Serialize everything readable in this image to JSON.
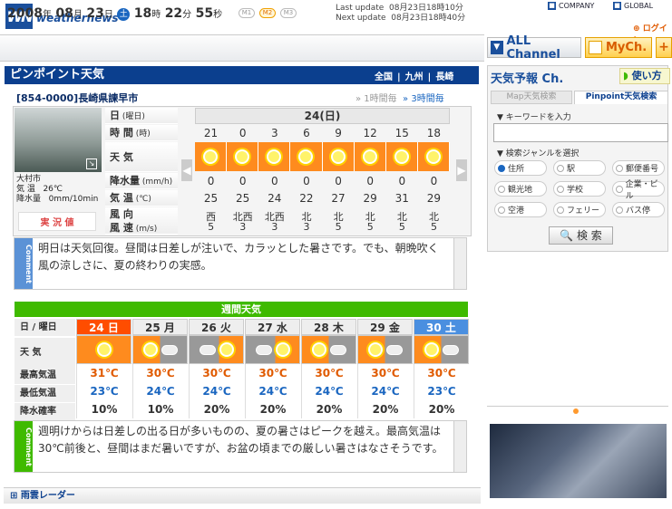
{
  "header": {
    "logo_mark": "WN",
    "logo_text": "weathernews",
    "links": {
      "company": "COMPANY",
      "global": "GLOBAL"
    },
    "login": "ログイン"
  },
  "datebar": {
    "year": "2008",
    "year_unit": "年",
    "month": "08",
    "month_unit": "月",
    "day": "23",
    "day_unit": "日",
    "day_of_week": "土",
    "hour": "18",
    "hour_unit": "時",
    "minute": "22",
    "minute_unit": "分",
    "second": "55",
    "second_unit": "秒",
    "levels": [
      "M1",
      "M2",
      "M3"
    ],
    "update_text": "Last update  08月23日18時10分\nNext update  08月23日18時40分"
  },
  "channels": {
    "all": "ALL Channel",
    "my": "MyCh.",
    "plus": "+"
  },
  "pinpoint": {
    "title": "ピンポイント天気",
    "breadcrumb": [
      "全国",
      "九州",
      "長崎"
    ],
    "location": "[854-0000]長崎県諫早市",
    "tab_1h": "1時間毎",
    "tab_3h": "3時間毎",
    "cam_city": "大村市",
    "cam_info": "気 温   26℃\n降水量   0mm/10min",
    "jikkyo": "実 況 値",
    "labels": {
      "day": "日",
      "day_unit": "(曜日)",
      "time": "時 間",
      "time_unit": "(時)",
      "weather": "天 気",
      "rain": "降水量",
      "rain_unit": "(mm/h)",
      "temp": "気 温",
      "temp_unit": "(℃)",
      "wind_dir": "風 向",
      "wind_speed": "風 速",
      "wind_unit": "(m/s)"
    },
    "date": "24(日)",
    "hours": [
      "21",
      "0",
      "3",
      "6",
      "9",
      "12",
      "15",
      "18"
    ],
    "weather_icons": [
      "sun-icon",
      "sun-icon",
      "sun-icon",
      "sun-icon",
      "sun-icon",
      "sun-icon",
      "sun-icon",
      "sun-icon"
    ],
    "rain": [
      "0",
      "0",
      "0",
      "0",
      "0",
      "0",
      "0",
      "0"
    ],
    "temps": [
      "25",
      "25",
      "24",
      "22",
      "27",
      "29",
      "31",
      "29"
    ],
    "wind_dirs": [
      "西",
      "北西",
      "北西",
      "北",
      "北",
      "北",
      "北",
      "北"
    ],
    "wind_speeds": [
      "5",
      "3",
      "3",
      "3",
      "5",
      "5",
      "5",
      "5"
    ],
    "comment_label": "Comment",
    "comment": "明日は天気回復。昼間は日差しが注いで、カラッとした暑さです。でも、朝晩吹く風の涼しさに、夏の終わりの実感。"
  },
  "weekly": {
    "title": "週間天気",
    "labels": {
      "day": "日 / 曜日",
      "weather": "天 気",
      "max": "最高気温",
      "min": "最低気温",
      "pop": "降水確率"
    },
    "days": [
      {
        "label": "24 日",
        "icon": "sunny",
        "max": "31℃",
        "min": "23℃",
        "pop": "10%",
        "color": "#ff4d00"
      },
      {
        "label": "25 月",
        "icon": "sunny-then-cloudy",
        "max": "30℃",
        "min": "24℃",
        "pop": "10%",
        "color": "#333333"
      },
      {
        "label": "26 火",
        "icon": "cloudy-then-sunny",
        "max": "30℃",
        "min": "24℃",
        "pop": "20%",
        "color": "#333333"
      },
      {
        "label": "27 水",
        "icon": "cloudy-then-sunny",
        "max": "30℃",
        "min": "24℃",
        "pop": "20%",
        "color": "#333333"
      },
      {
        "label": "28 木",
        "icon": "sunny-then-cloudy",
        "max": "30℃",
        "min": "24℃",
        "pop": "20%",
        "color": "#333333"
      },
      {
        "label": "29 金",
        "icon": "sunny-then-cloudy",
        "max": "30℃",
        "min": "24℃",
        "pop": "20%",
        "color": "#333333"
      },
      {
        "label": "30 土",
        "icon": "sunny-then-cloudy",
        "max": "30℃",
        "min": "23℃",
        "pop": "20%",
        "color": "#4a8fe0"
      }
    ],
    "comment_label": "Comment",
    "comment": "週明けからは日差しの出る日が多いものの、夏の暑さはピークを越え。最高気温は30℃前後と、昼間はまだ暑いですが、お盆の頃までの厳しい暑さはなさそうです。"
  },
  "radar": "雨雲レーダー",
  "right": {
    "title": "天気予報 Ch.",
    "howto": "使い方",
    "tab_map": "Map天気検索",
    "tab_pinpoint": "Pinpoint天気検索",
    "keyword_label": "▼ キーワードを入力",
    "genre_label": "▼ 検索ジャンルを選択",
    "options": [
      "住所",
      "駅",
      "郵便番号",
      "観光地",
      "学校",
      "企業・ビル",
      "空港",
      "フェリー",
      "バス停"
    ],
    "search": "検 索"
  }
}
